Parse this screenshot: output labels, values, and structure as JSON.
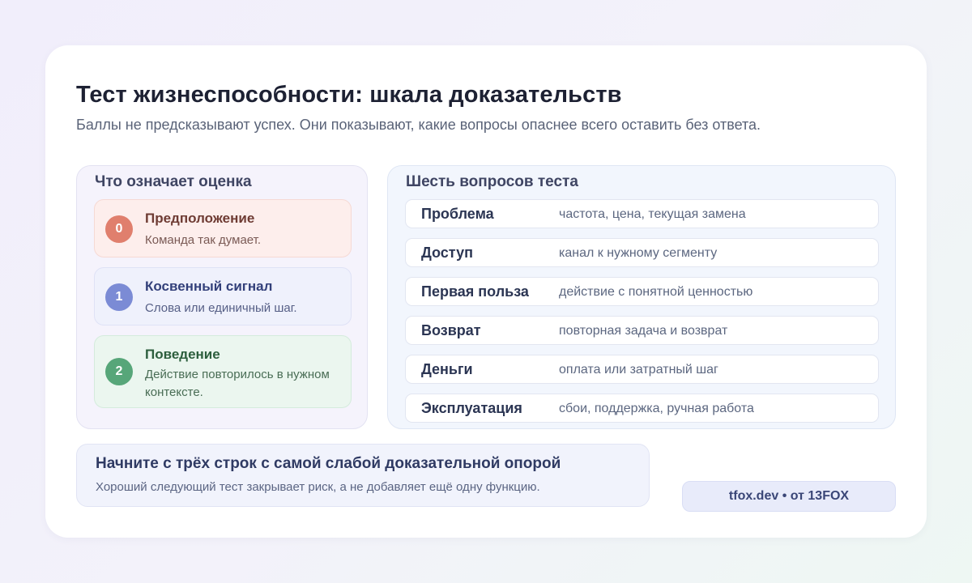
{
  "header": {
    "title": "Тест жизнеспособности: шкала доказательств",
    "subtitle": "Баллы не предсказывают успех. Они показывают, какие вопросы опаснее всего оставить без ответа."
  },
  "score_panel": {
    "title": "Что означает оценка",
    "levels": [
      {
        "score": "0",
        "name": "Предположение",
        "description": "Команда так думает.",
        "color": "#e07f6d"
      },
      {
        "score": "1",
        "name": "Косвенный сигнал",
        "description": "Слова или единичный шаг.",
        "color": "#7b8bd5"
      },
      {
        "score": "2",
        "name": "Поведение",
        "description": "Действие повторилось в нужном контексте.",
        "color": "#57a679"
      }
    ]
  },
  "questions_panel": {
    "title": "Шесть вопросов теста",
    "questions": [
      {
        "name": "Проблема",
        "description": "частота, цена, текущая замена"
      },
      {
        "name": "Доступ",
        "description": "канал к нужному сегменту"
      },
      {
        "name": "Первая польза",
        "description": "действие с понятной ценностью"
      },
      {
        "name": "Возврат",
        "description": "повторная задача и возврат"
      },
      {
        "name": "Деньги",
        "description": "оплата или затратный шаг"
      },
      {
        "name": "Эксплуатация",
        "description": "сбои, поддержка, ручная работа"
      }
    ]
  },
  "footer": {
    "title": "Начните с трёх строк с самой слабой доказательной опорой",
    "description": "Хороший следующий тест закрывает риск, а не добавляет ещё одну функцию.",
    "brand": "tfox.dev • от 13FOX"
  }
}
